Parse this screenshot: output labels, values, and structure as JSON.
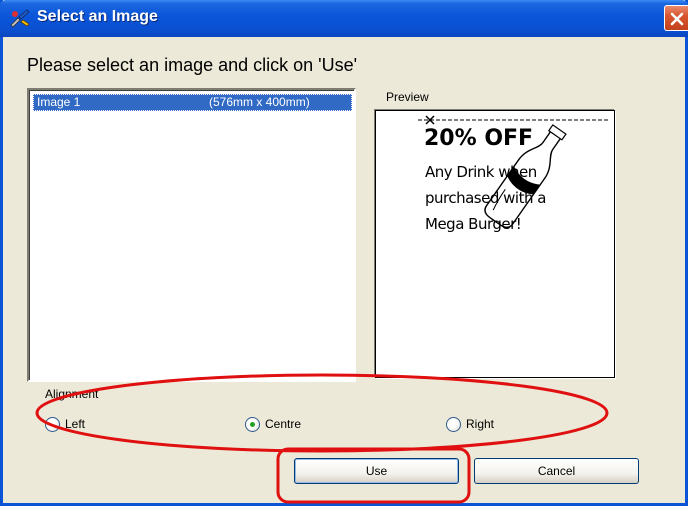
{
  "window": {
    "title": "Select an Image",
    "close_icon": "close-icon",
    "app_icon": "paint-icon"
  },
  "heading": "Please select an image and click on 'Use'",
  "image_list": {
    "items": [
      {
        "name": "Image 1",
        "size": "(576mm x 400mm)",
        "selected": true
      }
    ]
  },
  "preview": {
    "label": "Preview",
    "ticket": {
      "headline": "20% OFF",
      "lines": [
        "Any Drink when",
        "purchased with a",
        "Mega Burger!"
      ],
      "illustration": "bottle-icon",
      "cut_marker": "scissors-icon"
    }
  },
  "alignment": {
    "label": "Alignment",
    "options": [
      "Left",
      "Centre",
      "Right"
    ],
    "selected": "Centre"
  },
  "buttons": {
    "use": "Use",
    "cancel": "Cancel"
  },
  "colors": {
    "titlebar": "#0a55d9",
    "selection": "#316ac5",
    "annotation": "#e01010",
    "dialog_bg": "#ece9d8"
  }
}
